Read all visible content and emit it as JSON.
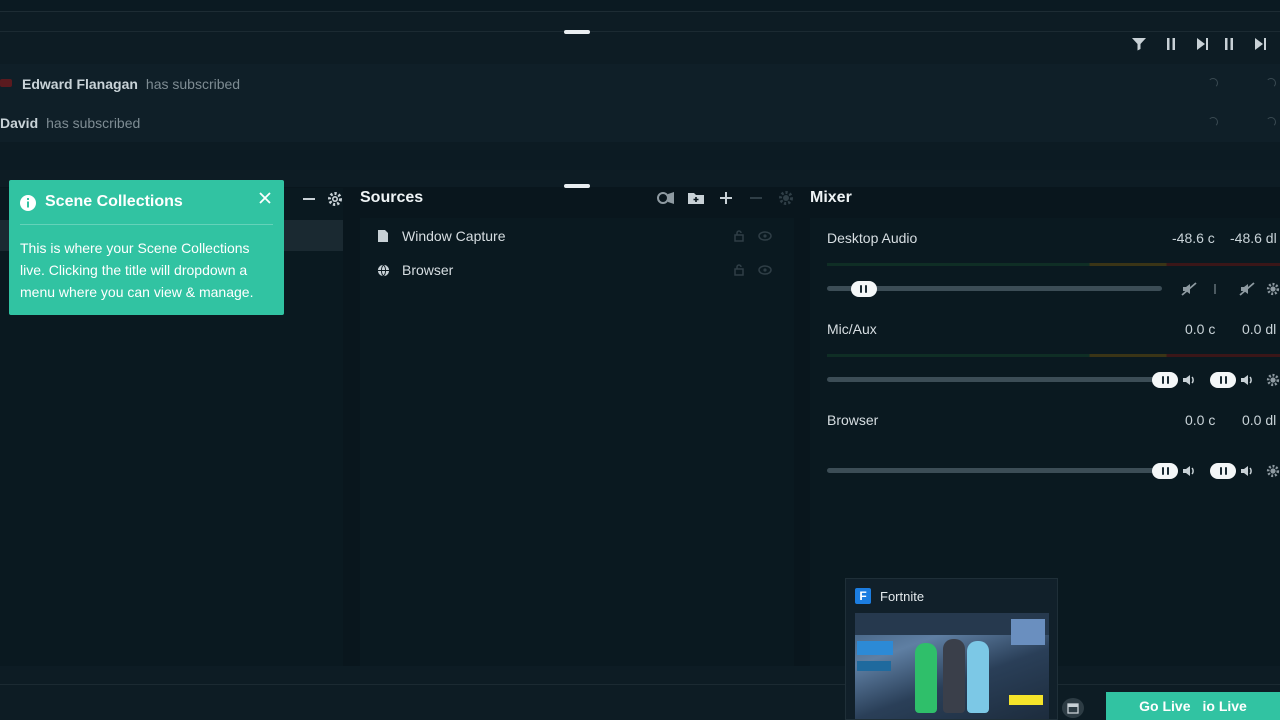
{
  "events": {
    "items": [
      {
        "name": "Edward Flanagan",
        "action": "has subscribed"
      },
      {
        "name": "David",
        "action": "has subscribed"
      }
    ]
  },
  "sources": {
    "title": "Sources",
    "items": [
      {
        "label": "Window Capture",
        "icon": "file-icon"
      },
      {
        "label": "Browser",
        "icon": "globe-icon"
      }
    ]
  },
  "mixer": {
    "title": "Mixer",
    "channels": [
      {
        "name": "Desktop Audio",
        "db_a": "-48.6 c",
        "db_b": "-48.6 dl",
        "level": 0.1
      },
      {
        "name": "Mic/Aux",
        "db_a": "0.0 c",
        "db_b": "0.0 dl",
        "level": 1.0
      },
      {
        "name": "Browser",
        "db_a": "0.0 c",
        "db_b": "0.0 dl",
        "level": 1.0
      }
    ]
  },
  "tooltip": {
    "title": "Scene Collections",
    "body": "This is where your Scene Collections live. Clicking the title will dropdown a menu where you can view & manage."
  },
  "taskbar_preview": {
    "app_letter": "F",
    "title": "Fortnite"
  },
  "go_live": {
    "label": "Go Live",
    "label_ghost": "io Live"
  },
  "colors": {
    "accent": "#31c3a2",
    "background": "#09161d",
    "panel": "#0a1920"
  }
}
